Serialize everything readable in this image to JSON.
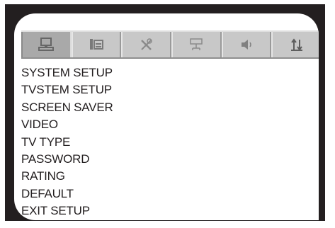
{
  "tabs": [
    {
      "icon": "computer-icon",
      "active": true
    },
    {
      "icon": "tv-setup-icon",
      "active": false
    },
    {
      "icon": "tools-icon",
      "active": false
    },
    {
      "icon": "network-icon",
      "active": false
    },
    {
      "icon": "speaker-icon",
      "active": false
    },
    {
      "icon": "sort-icon",
      "active": false
    }
  ],
  "menu": {
    "items": [
      "SYSTEM SETUP",
      "TVSTEM SETUP",
      "SCREEN SAVER",
      "VIDEO",
      "TV TYPE",
      "PASSWORD",
      "RATING",
      "DEFAULT",
      "EXIT SETUP"
    ]
  },
  "colors": {
    "bezel": "#231f20",
    "tab_bar": "#c4c4c4",
    "tab_active": "#a9a9a9",
    "icon": "#6e6e6e",
    "text": "#231f20"
  }
}
